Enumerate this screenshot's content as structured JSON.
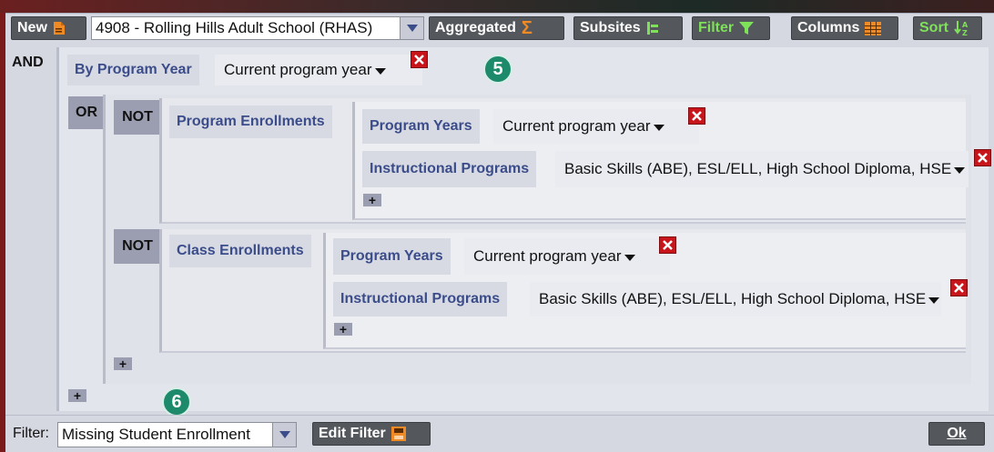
{
  "toolbar": {
    "new_label": "New",
    "school_select": "4908 - Rolling Hills Adult School (RHAS)",
    "aggregated_label": "Aggregated",
    "subsites_label": "Subsites",
    "filter_label": "Filter",
    "columns_label": "Columns",
    "sort_label": "Sort"
  },
  "query": {
    "root_logic": "AND",
    "by_program_year": {
      "label": "By Program Year",
      "value": "Current program year"
    },
    "or_logic": "OR",
    "groups": [
      {
        "logic": "NOT",
        "title": "Program Enrollments",
        "conditions": [
          {
            "label": "Program Years",
            "value": "Current program year"
          },
          {
            "label": "Instructional Programs",
            "value": "Basic Skills (ABE), ESL/ELL, High School Diploma, HSE"
          }
        ]
      },
      {
        "logic": "NOT",
        "title": "Class Enrollments",
        "conditions": [
          {
            "label": "Program Years",
            "value": "Current program year"
          },
          {
            "label": "Instructional Programs",
            "value": "Basic Skills (ABE), ESL/ELL, High School Diploma, HSE"
          }
        ]
      }
    ],
    "plus": "+"
  },
  "badges": {
    "step5": "5",
    "step6": "6"
  },
  "footer": {
    "filter_label": "Filter:",
    "filter_value": "Missing Student Enrollment",
    "edit_filter_label": "Edit Filter",
    "ok_label": "Ok"
  },
  "colors": {
    "accent_orange": "#f08a24",
    "filter_green": "#7fe05a",
    "remove_red": "#c8151b",
    "badge_teal": "#1e8a6c"
  }
}
